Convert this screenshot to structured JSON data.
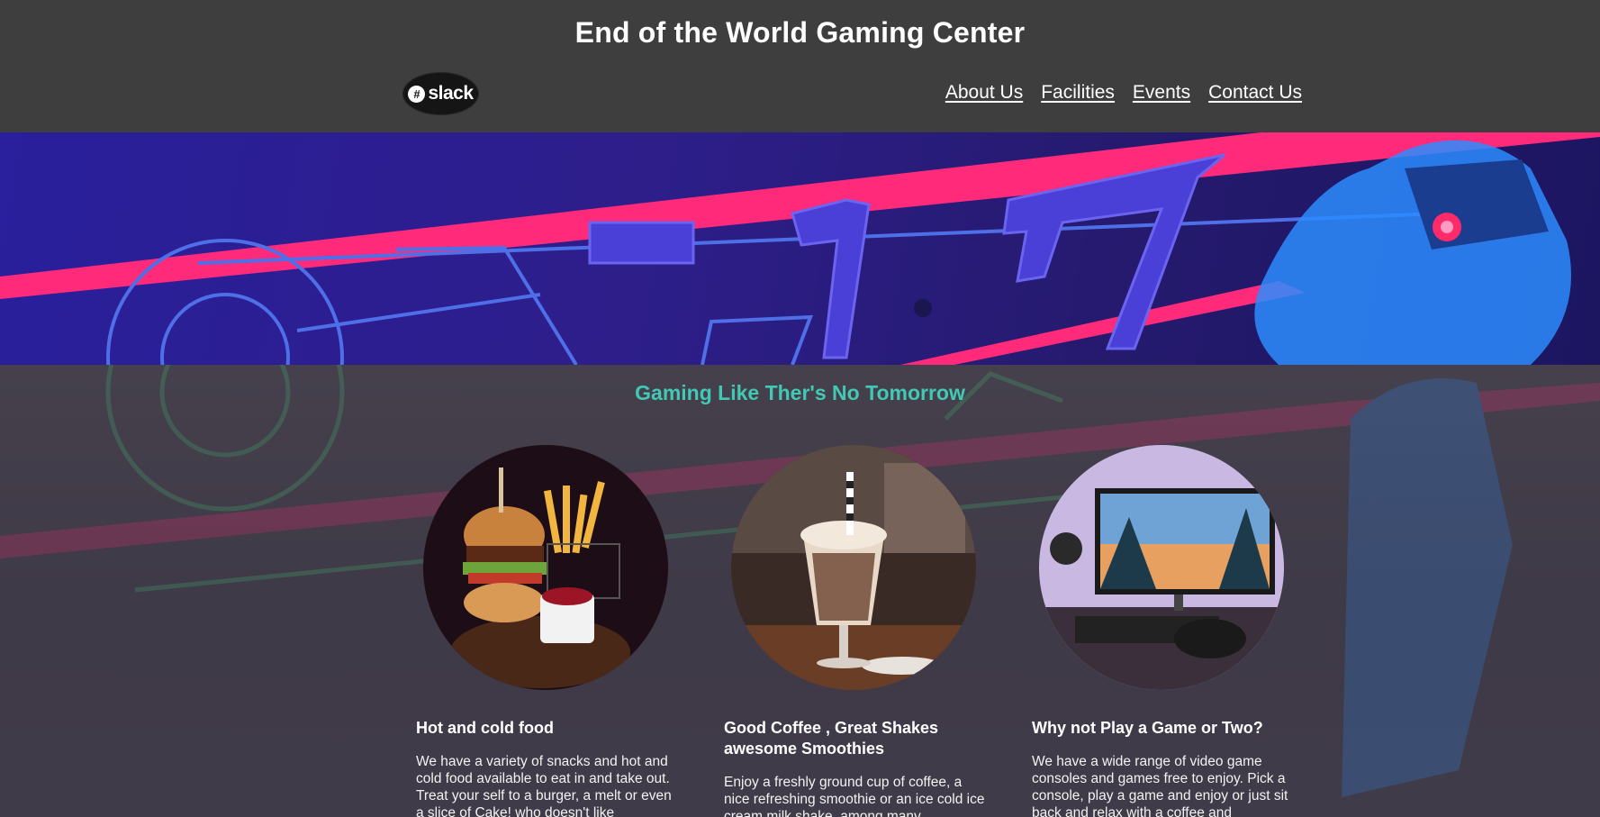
{
  "header": {
    "title": "End of the World Gaming Center",
    "logo": {
      "icon": "slack-hash-icon",
      "text": "slack"
    },
    "nav": [
      {
        "label": "About Us"
      },
      {
        "label": "Facilities"
      },
      {
        "label": "Events"
      },
      {
        "label": "Contact Us"
      }
    ]
  },
  "hero": {
    "image": "neon-arcade-joystick-banner"
  },
  "main": {
    "tagline": "Gaming Like Ther's No Tomorrow",
    "cards": [
      {
        "image": "burger-and-fries-photo",
        "title": "Hot and cold food",
        "text": "We have a variety of snacks and hot and cold food available to eat in and take out. Treat your self to a burger, a melt or even a slice of Cake! who doesn't like"
      },
      {
        "image": "milkshake-photo",
        "title": "Good Coffee , Great Shakes awesome Smoothies",
        "text": "Enjoy a freshly ground cup of coffee, a nice refreshing smoothie or an ice cold ice cream milk shake, among many"
      },
      {
        "image": "gaming-desk-setup-photo",
        "title": "Why not Play a Game or Two?",
        "text": "We have a wide range of video game consoles and games free to enjoy. Pick a console, play a game and enjoy or just sit back and relax with a coffee and"
      }
    ]
  },
  "colors": {
    "header_bg": "#3e3e3e",
    "accent_teal": "#42c9b3",
    "neon_pink": "#ff2a7a",
    "neon_blue": "#3a8bff"
  }
}
